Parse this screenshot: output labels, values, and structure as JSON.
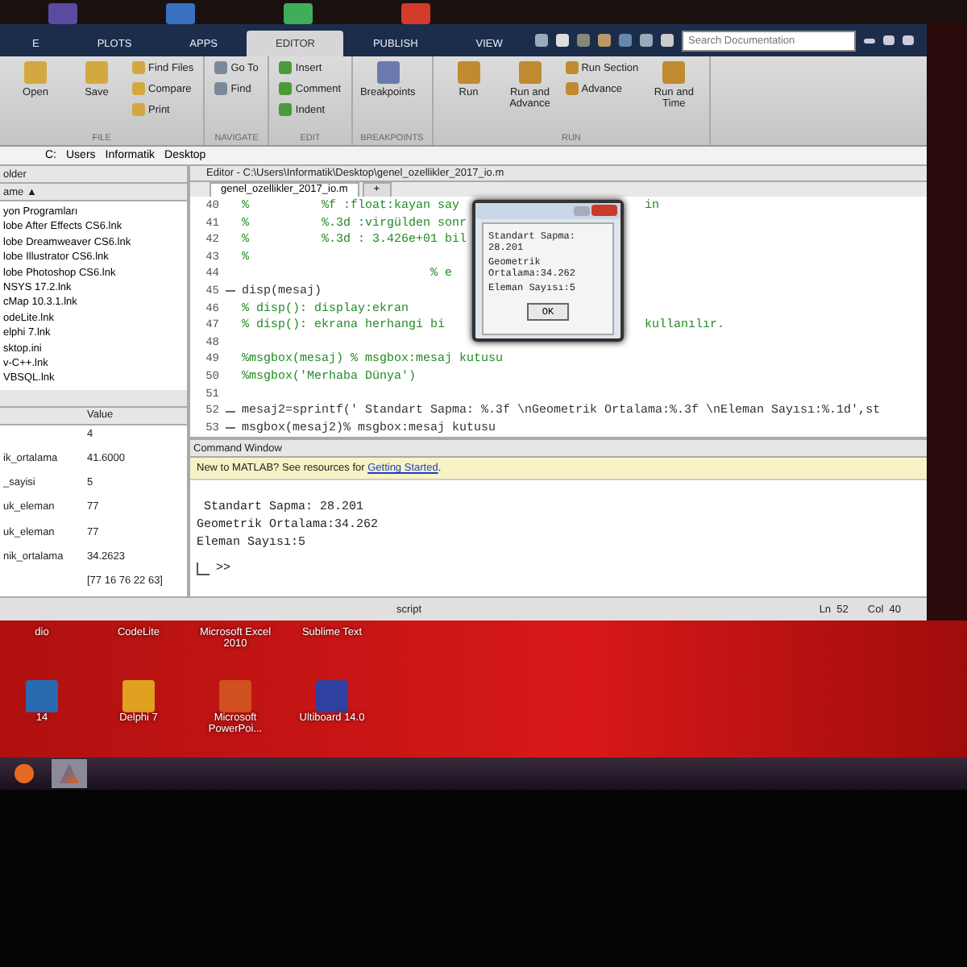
{
  "window_tabs": [
    {
      "label": "E",
      "selected": false
    },
    {
      "label": "PLOTS",
      "selected": false
    },
    {
      "label": "APPS",
      "selected": false
    },
    {
      "label": "EDITOR",
      "selected": true
    },
    {
      "label": "PUBLISH",
      "selected": false
    },
    {
      "label": "VIEW",
      "selected": false
    }
  ],
  "search": {
    "placeholder": "Search Documentation"
  },
  "ribbon": [
    {
      "label": "FILE",
      "items": [
        {
          "label": "Open",
          "kind": "large"
        },
        {
          "label": "Save",
          "kind": "large"
        },
        {
          "label": "Find Files",
          "kind": "small"
        },
        {
          "label": "Compare",
          "kind": "small"
        },
        {
          "label": "Print",
          "kind": "small"
        }
      ]
    },
    {
      "label": "NAVIGATE",
      "items": [
        {
          "label": "Go To",
          "kind": "small"
        },
        {
          "label": "Find",
          "kind": "small"
        }
      ]
    },
    {
      "label": "EDIT",
      "items": [
        {
          "label": "Insert",
          "kind": "small"
        },
        {
          "label": "Comment",
          "kind": "small"
        },
        {
          "label": "Indent",
          "kind": "small"
        }
      ]
    },
    {
      "label": "BREAKPOINTS",
      "items": [
        {
          "label": "Breakpoints",
          "kind": "large"
        }
      ]
    },
    {
      "label": "RUN",
      "items": [
        {
          "label": "Run",
          "kind": "large"
        },
        {
          "label": "Run and Advance",
          "kind": "large"
        },
        {
          "label": "Run Section",
          "kind": "small"
        },
        {
          "label": "Advance",
          "kind": "small"
        },
        {
          "label": "Run and Time",
          "kind": "large"
        }
      ]
    }
  ],
  "address": [
    "C:",
    "Users",
    "Informatik",
    "Desktop"
  ],
  "folder": {
    "title": "older",
    "column": "ame ▲",
    "items": [
      "yon Programları",
      "lobe After Effects CS6.lnk",
      "lobe Dreamweaver CS6.lnk",
      "lobe Illustrator CS6.lnk",
      "lobe Photoshop CS6.lnk",
      "NSYS 17.2.lnk",
      "cMap 10.3.1.lnk",
      "odeLite.lnk",
      "elphi 7.lnk",
      "sktop.ini",
      "v-C++.lnk",
      "VBSQL.lnk"
    ]
  },
  "workspace": {
    "column": "Value",
    "rows": [
      {
        "value": "4"
      },
      {
        "name": "ik_ortalama",
        "value": "41.6000"
      },
      {
        "name": "_sayisi",
        "value": "5"
      },
      {
        "name": "uk_eleman",
        "value": "77"
      },
      {
        "name": "uk_eleman",
        "value": "77"
      },
      {
        "name": "nik_ortalama",
        "value": "34.2623"
      },
      {
        "value": "[77 16 76 22 63]"
      }
    ]
  },
  "editor": {
    "title": "Editor - C:\\Users\\Informatik\\Desktop\\genel_ozellikler_2017_io.m",
    "tabs": [
      {
        "label": "genel_ozellikler_2017_io.m",
        "selected": true
      },
      {
        "label": "+",
        "selected": false
      }
    ],
    "lines": [
      {
        "num": "40",
        "text": "%          %f :float:kayan say",
        "after": "in",
        "marker": false
      },
      {
        "num": "41",
        "text": "%          %.3d :virgülden sonr",
        "marker": false
      },
      {
        "num": "42",
        "text": "%          %.3d : 3.426e+01 bil",
        "marker": false
      },
      {
        "num": "43",
        "text": "%",
        "marker": false
      },
      {
        "num": "44",
        "text": "                          % e",
        "marker": false
      },
      {
        "num": "45",
        "text": "disp(mesaj)",
        "marker": true
      },
      {
        "num": "46",
        "text": "% disp(): display:ekran",
        "marker": false
      },
      {
        "num": "47",
        "text": "% disp(): ekrana herhangi bi",
        "after": "kullanılır.",
        "marker": false
      },
      {
        "num": "48",
        "marker": false
      },
      {
        "num": "49",
        "text": "%msgbox(mesaj) % msgbox:mesaj kutusu",
        "marker": false
      },
      {
        "num": "50",
        "text": "%msgbox('Merhaba Dünya')",
        "marker": false
      },
      {
        "num": "51",
        "marker": false
      },
      {
        "num": "52",
        "text": "mesaj2=sprintf(' Standart Sapma: %.3f \\nGeometrik Ortalama:%.3f \\nEleman Sayısı:%.1d',st",
        "marker": true
      },
      {
        "num": "53",
        "text": "msgbox(mesaj2)% msgbox:mesaj kutusu",
        "marker": true
      }
    ],
    "dialog": {
      "lines": [
        "Standart Sapma: 28.201",
        "Geometrik Ortalama:34.262",
        "Eleman Sayısı:5"
      ],
      "button": "OK"
    }
  },
  "command": {
    "title": "Command Window",
    "banner": "New to MATLAB? See resources for ",
    "link": "Getting Started",
    "banner_end": ".",
    "output": [
      " Standart Sapma: 28.201",
      "Geometrik Ortalama:34.262",
      "Eleman Sayısı:5"
    ],
    "prompt": ">>"
  },
  "status": {
    "mode": "script",
    "line": "Ln  52",
    "col": "Col  40"
  },
  "desktop": {
    "icons": [
      {
        "label": "dio",
        "kind": "label"
      },
      {
        "label": "CodeLite",
        "kind": "label"
      },
      {
        "label": "Microsoft Excel 2010",
        "kind": "label"
      },
      {
        "label": "Sublime Text",
        "kind": "label"
      },
      {
        "label": "14",
        "kind": "app"
      },
      {
        "label": "Delphi 7",
        "kind": "app"
      },
      {
        "label": "Microsoft PowerPoi...",
        "kind": "app"
      },
      {
        "label": "Ultiboard 14.0",
        "kind": "app"
      }
    ],
    "taskbar": [
      {
        "kind": "browser",
        "selected": false
      },
      {
        "kind": "matlab",
        "selected": true
      }
    ]
  }
}
